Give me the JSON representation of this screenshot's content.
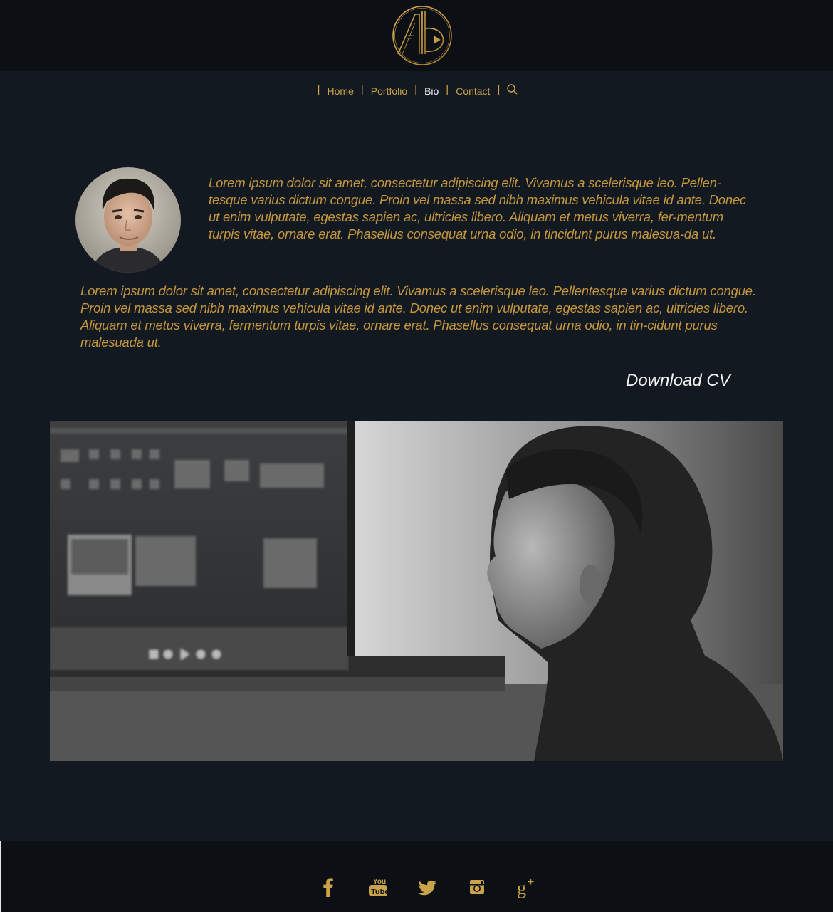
{
  "header": {
    "logo_icon": "ab-monogram-logo-icon"
  },
  "nav": {
    "items": [
      {
        "label": "Home"
      },
      {
        "label": "Portfolio"
      },
      {
        "label": "Bio"
      },
      {
        "label": "Contact"
      }
    ],
    "active": "Bio",
    "search_icon": "search-icon"
  },
  "bio": {
    "paragraph_1": "Lorem ipsum dolor sit amet, consectetur adipiscing elit. Vivamus a scelerisque leo. Pellen-tesque varius dictum congue. Proin vel massa sed nibh maximus vehicula vitae id ante. Donec ut enim vulputate, egestas sapien ac, ultricies libero. Aliquam et metus viverra, fer-mentum turpis vitae, ornare erat. Phasellus consequat urna odio, in tincidunt purus malesua-da ut.",
    "paragraph_2": "Lorem ipsum dolor sit amet, consectetur adipiscing elit. Vivamus a scelerisque leo. Pellentesque varius dictum congue. Proin vel massa sed nibh maximus vehicula vitae id ante. Donec ut enim vulputate, egestas sapien ac, ultricies libero. Aliquam et metus viverra, fermentum turpis vitae, ornare erat. Phasellus consequat urna odio, in tin-cidunt purus malesuada ut.",
    "download_label": "Download CV"
  },
  "footer": {
    "social": [
      {
        "icon": "facebook-icon"
      },
      {
        "icon": "youtube-icon",
        "label": "You Tube"
      },
      {
        "icon": "twitter-icon"
      },
      {
        "icon": "instagram-icon"
      },
      {
        "icon": "google-plus-icon",
        "label": "g+"
      }
    ]
  },
  "colors": {
    "background": "#131920",
    "header_footer": "#0c1014",
    "gold": "#c4963e",
    "active_text": "#f2f2f2"
  }
}
